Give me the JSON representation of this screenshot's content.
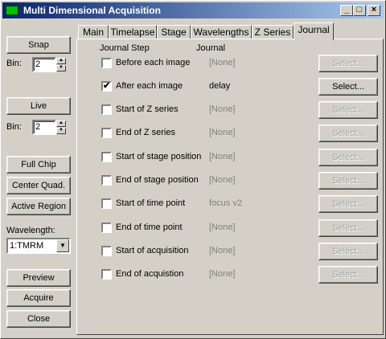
{
  "window": {
    "title": "Multi Dimensional Acquisition"
  },
  "titlebar_buttons": {
    "minimize": "_",
    "maximize": "□",
    "close": "×"
  },
  "left": {
    "snap": "Snap",
    "bin1_label": "Bin:",
    "bin1_value": "2",
    "live": "Live",
    "bin2_label": "Bin:",
    "bin2_value": "2",
    "full_chip": "Full Chip",
    "center_quad": "Center Quad.",
    "active_region": "Active Region",
    "wavelength_label": "Wavelength:",
    "wavelength_value": "1:TMRM",
    "preview": "Preview",
    "acquire": "Acquire",
    "close": "Close"
  },
  "tabs": [
    "Main",
    "Timelapse",
    "Stage",
    "Wavelengths",
    "Z Series",
    "Journal"
  ],
  "active_tab": "Journal",
  "journal": {
    "col_step": "Journal Step",
    "col_journal": "Journal",
    "rows": [
      {
        "label": "Before each image",
        "checked": false,
        "journal": "[None]",
        "button": "Select...",
        "enabled": false
      },
      {
        "label": "After each image",
        "checked": true,
        "journal": "delay",
        "button": "Select...",
        "enabled": true
      },
      {
        "label": "Start of Z series",
        "checked": false,
        "journal": "[None]",
        "button": "Select...",
        "enabled": false
      },
      {
        "label": "End of Z series",
        "checked": false,
        "journal": "[None]",
        "button": "Select...",
        "enabled": false
      },
      {
        "label": "Start of stage position",
        "checked": false,
        "journal": "[None]",
        "button": "Select...",
        "enabled": false
      },
      {
        "label": "End of stage position",
        "checked": false,
        "journal": "[None]",
        "button": "Select...",
        "enabled": false
      },
      {
        "label": "Start of time point",
        "checked": false,
        "journal": "focus v2",
        "button": "Select...",
        "enabled": false
      },
      {
        "label": "End of time point",
        "checked": false,
        "journal": "[None]",
        "button": "Select...",
        "enabled": false
      },
      {
        "label": "Start of acquisition",
        "checked": false,
        "journal": "[None]",
        "button": "Select...",
        "enabled": false
      },
      {
        "label": "End of acquistion",
        "checked": false,
        "journal": "[None]",
        "button": "Select...",
        "enabled": false
      }
    ]
  }
}
